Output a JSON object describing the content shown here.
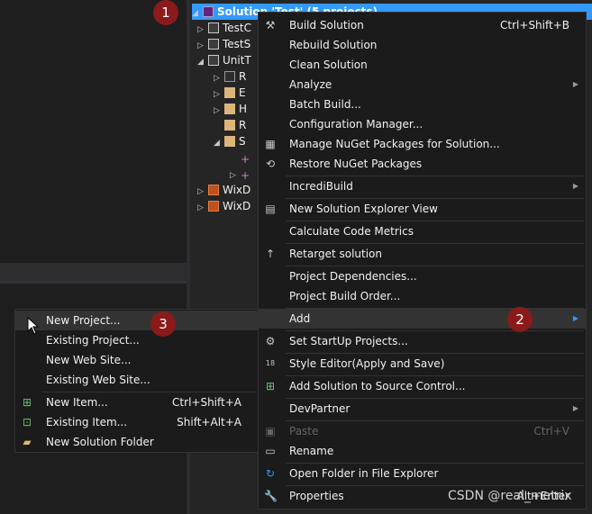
{
  "tree": {
    "solution_label": "Solution 'Test' (5 projects)",
    "items": [
      {
        "label": "TestC",
        "expanded": false
      },
      {
        "label": "TestS",
        "expanded": false
      },
      {
        "label": "UnitT",
        "expanded": true
      },
      {
        "label": "R",
        "expanded": false
      },
      {
        "label": "E",
        "expanded": false
      },
      {
        "label": "H",
        "expanded": false
      },
      {
        "label": "R",
        "expanded": false
      },
      {
        "label": "S",
        "expanded": true
      },
      {
        "label": "",
        "expanded": false
      },
      {
        "label": "",
        "expanded": false
      },
      {
        "label": "WixD",
        "expanded": false
      },
      {
        "label": "WixD",
        "expanded": false
      }
    ]
  },
  "context_menu": {
    "items": [
      {
        "label": "Build Solution",
        "shortcut": "Ctrl+Shift+B",
        "icon": "build-icon"
      },
      {
        "label": "Rebuild Solution"
      },
      {
        "label": "Clean Solution"
      },
      {
        "label": "Analyze",
        "submenu": true
      },
      {
        "label": "Batch Build..."
      },
      {
        "label": "Configuration Manager..."
      },
      {
        "label": "Manage NuGet Packages for Solution...",
        "icon": "nuget-icon"
      },
      {
        "label": "Restore NuGet Packages",
        "icon": "restore-icon"
      },
      {
        "label": "IncrediBuild",
        "submenu": true
      },
      {
        "label": "New Solution Explorer View",
        "icon": "new-view-icon"
      },
      {
        "label": "Calculate Code Metrics"
      },
      {
        "label": "Retarget solution",
        "icon": "arrow-up-icon"
      },
      {
        "label": "Project Dependencies..."
      },
      {
        "label": "Project Build Order..."
      },
      {
        "label": "Add",
        "submenu": true
      },
      {
        "label": "Set StartUp Projects...",
        "icon": "gear-icon"
      },
      {
        "label": "Style Editor(Apply and Save)",
        "icon": "style-icon"
      },
      {
        "label": "Add Solution to Source Control...",
        "icon": "source-control-icon"
      },
      {
        "label": "DevPartner",
        "submenu": true
      },
      {
        "label": "Paste",
        "shortcut": "Ctrl+V",
        "disabled": true,
        "icon": "paste-icon"
      },
      {
        "label": "Rename",
        "icon": "rename-icon"
      },
      {
        "label": "Open Folder in File Explorer",
        "icon": "refresh-icon"
      },
      {
        "label": "Properties",
        "shortcut": "Alt+Enter",
        "icon": "wrench-icon"
      }
    ]
  },
  "add_submenu": {
    "items": [
      {
        "label": "New Project..."
      },
      {
        "label": "Existing Project..."
      },
      {
        "label": "New Web Site..."
      },
      {
        "label": "Existing Web Site..."
      },
      {
        "label": "New Item...",
        "shortcut": "Ctrl+Shift+A",
        "icon": "new-item-icon"
      },
      {
        "label": "Existing Item...",
        "shortcut": "Shift+Alt+A",
        "icon": "existing-item-icon"
      },
      {
        "label": "New Solution Folder",
        "icon": "folder-icon"
      }
    ]
  },
  "badges": [
    "1",
    "2",
    "3"
  ],
  "watermark": "CSDN @real_metrix",
  "colors": {
    "selection": "#3399ff",
    "badge": "#8b1a1a",
    "menu_bg": "#1b1b1c"
  }
}
